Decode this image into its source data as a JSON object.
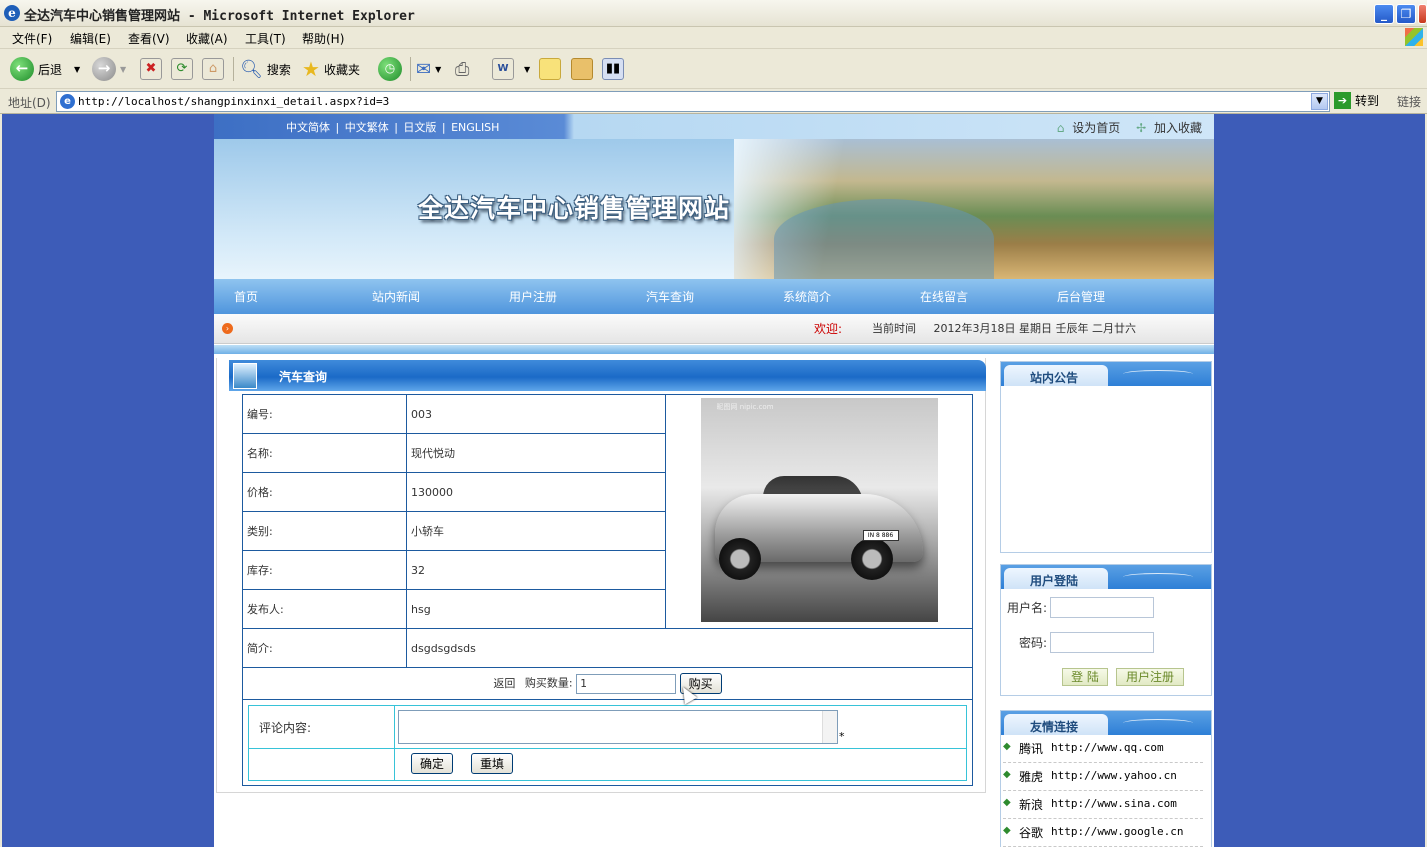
{
  "window": {
    "title": "全达汽车中心销售管理网站 - Microsoft Internet Explorer"
  },
  "menu": [
    "文件(F)",
    "编辑(E)",
    "查看(V)",
    "收藏(A)",
    "工具(T)",
    "帮助(H)"
  ],
  "toolbar": {
    "back": "后退",
    "search": "搜索",
    "favorites": "收藏夹"
  },
  "address": {
    "label": "地址(D)",
    "url": "http://localhost/shangpinxinxi_detail.aspx?id=3",
    "go": "转到",
    "links": "链接"
  },
  "site": {
    "langs": [
      "中文简体",
      "中文繁体",
      "日文版",
      "ENGLISH"
    ],
    "set_home": "设为首页",
    "add_fav": "加入收藏",
    "title": "全达汽车中心销售管理网站",
    "nav": [
      "首页",
      "站内新闻",
      "用户注册",
      "汽车查询",
      "系统简介",
      "在线留言",
      "后台管理"
    ],
    "welcome": "欢迎:",
    "time_label": "当前时间",
    "time_value": "2012年3月18日  星期日  壬辰年  二月廿六"
  },
  "detail": {
    "panel_title": "汽车查询",
    "rows": [
      {
        "k": "编号:",
        "v": "003"
      },
      {
        "k": "名称:",
        "v": "现代悦动"
      },
      {
        "k": "价格:",
        "v": "130000"
      },
      {
        "k": "类别:",
        "v": "小轿车"
      },
      {
        "k": "库存:",
        "v": "32"
      },
      {
        "k": "发布人:",
        "v": "hsg"
      },
      {
        "k": "简介:",
        "v": "dsgdsgdsds"
      }
    ],
    "image_watermark": "昵图网 nipic.com",
    "image_plate": "IN 8 886",
    "back": "返回",
    "qty_label": "购买数量:",
    "qty_value": "1",
    "buy": "购买",
    "comment_label": "评论内容:",
    "comment_star": "*",
    "confirm": "确定",
    "reset": "重填"
  },
  "sidebar": {
    "notice_title": "站内公告",
    "login_title": "用户登陆",
    "username_label": "用户名:",
    "password_label": "密码:",
    "login_btn": "登 陆",
    "register_btn": "用户注册",
    "links_title": "友情连接",
    "links": [
      {
        "name": "腾讯",
        "url": "http://www.qq.com"
      },
      {
        "name": "雅虎",
        "url": "http://www.yahoo.cn"
      },
      {
        "name": "新浪",
        "url": "http://www.sina.com"
      },
      {
        "name": "谷歌",
        "url": "http://www.google.cn"
      }
    ]
  }
}
